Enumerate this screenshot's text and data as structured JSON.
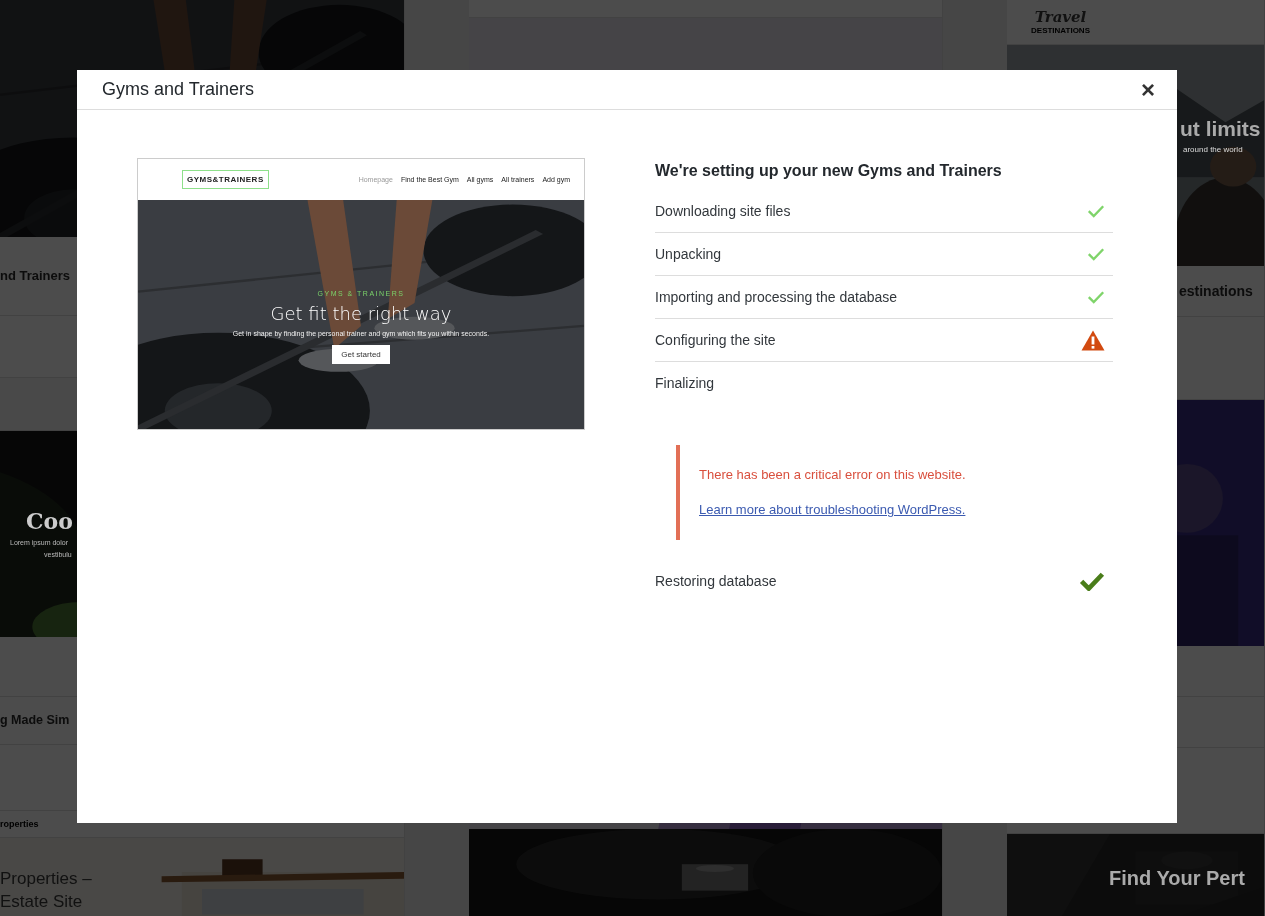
{
  "background": {
    "left_column": {
      "card_title": "nd Trainers",
      "picture_heading": "Coo",
      "picture_text": [
        "Lorem ipsum dolor",
        "vestibulu"
      ],
      "second_title": "g Made Sim",
      "third_header": "roperties",
      "third_picture_text": [
        "Properties –",
        "Estate Site"
      ]
    },
    "right_column": {
      "logo": "Travel",
      "logo_sub": "DESTINATIONS",
      "picture_heading": "ut limits",
      "picture_text": "around the world",
      "card_title": "estinations",
      "bottom_heading": "Find Your Pert"
    }
  },
  "dialog": {
    "title": "Gyms and Trainers",
    "close": "×",
    "preview": {
      "logo": "GYMS&TRAINERS",
      "nav": [
        {
          "label": "Homepage",
          "selected": true
        },
        {
          "label": "Find the Best Gym",
          "selected": false
        },
        {
          "label": "All gyms",
          "selected": false
        },
        {
          "label": "All trainers",
          "selected": false
        },
        {
          "label": "Add gym",
          "selected": false
        }
      ],
      "kicker": "GYMS & TRAINERS",
      "heading": "Get fit the right way",
      "text": "Get in shape by finding the personal trainer and gym which fits you within seconds.",
      "button": "Get started"
    },
    "heading": "We're setting up your new Gyms and Trainers",
    "steps": [
      {
        "label": "Downloading site files",
        "done": true,
        "failed": false
      },
      {
        "label": "Unpacking",
        "done": true,
        "failed": false
      },
      {
        "label": "Importing and processing the database",
        "done": true,
        "failed": false
      },
      {
        "label": "Configuring the site",
        "done": false,
        "failed": true
      },
      {
        "label": "Finalizing",
        "done": false,
        "failed": false
      }
    ],
    "error": {
      "message": "There has been a critical error on this website.",
      "link": "Learn more about troubleshooting WordPress."
    },
    "restore": {
      "label": "Restoring database",
      "done": true
    }
  }
}
